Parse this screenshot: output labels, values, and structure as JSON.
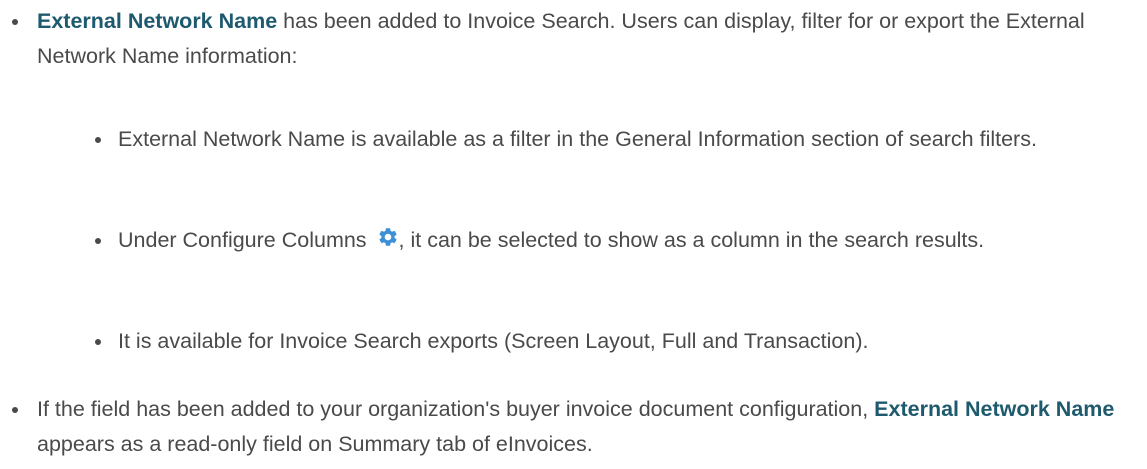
{
  "bullets": [
    {
      "bold_lead": "External Network Name",
      "text": " has been added to Invoice Search. Users can display, filter for or export the External Network Name information:",
      "sub_bullets": [
        {
          "text": "External Network Name is available as a filter in the General Information section of search filters."
        },
        {
          "text_before_icon": "Under Configure Columns ",
          "icon": "gear-icon",
          "text_after_icon": ", it can be selected to show as a column in the search results."
        },
        {
          "text": "It is available for Invoice Search exports (Screen Layout, Full and Transaction)."
        }
      ]
    },
    {
      "text_before": "If the field has been added to your organization's buyer invoice document configuration, ",
      "bold": "External Network Name",
      "text_after": " appears as a read-only field on Summary tab of eInvoices."
    }
  ],
  "colors": {
    "text": "#4a4a4a",
    "bold_text": "#1e5a6e",
    "icon": "#3d8fd6"
  }
}
